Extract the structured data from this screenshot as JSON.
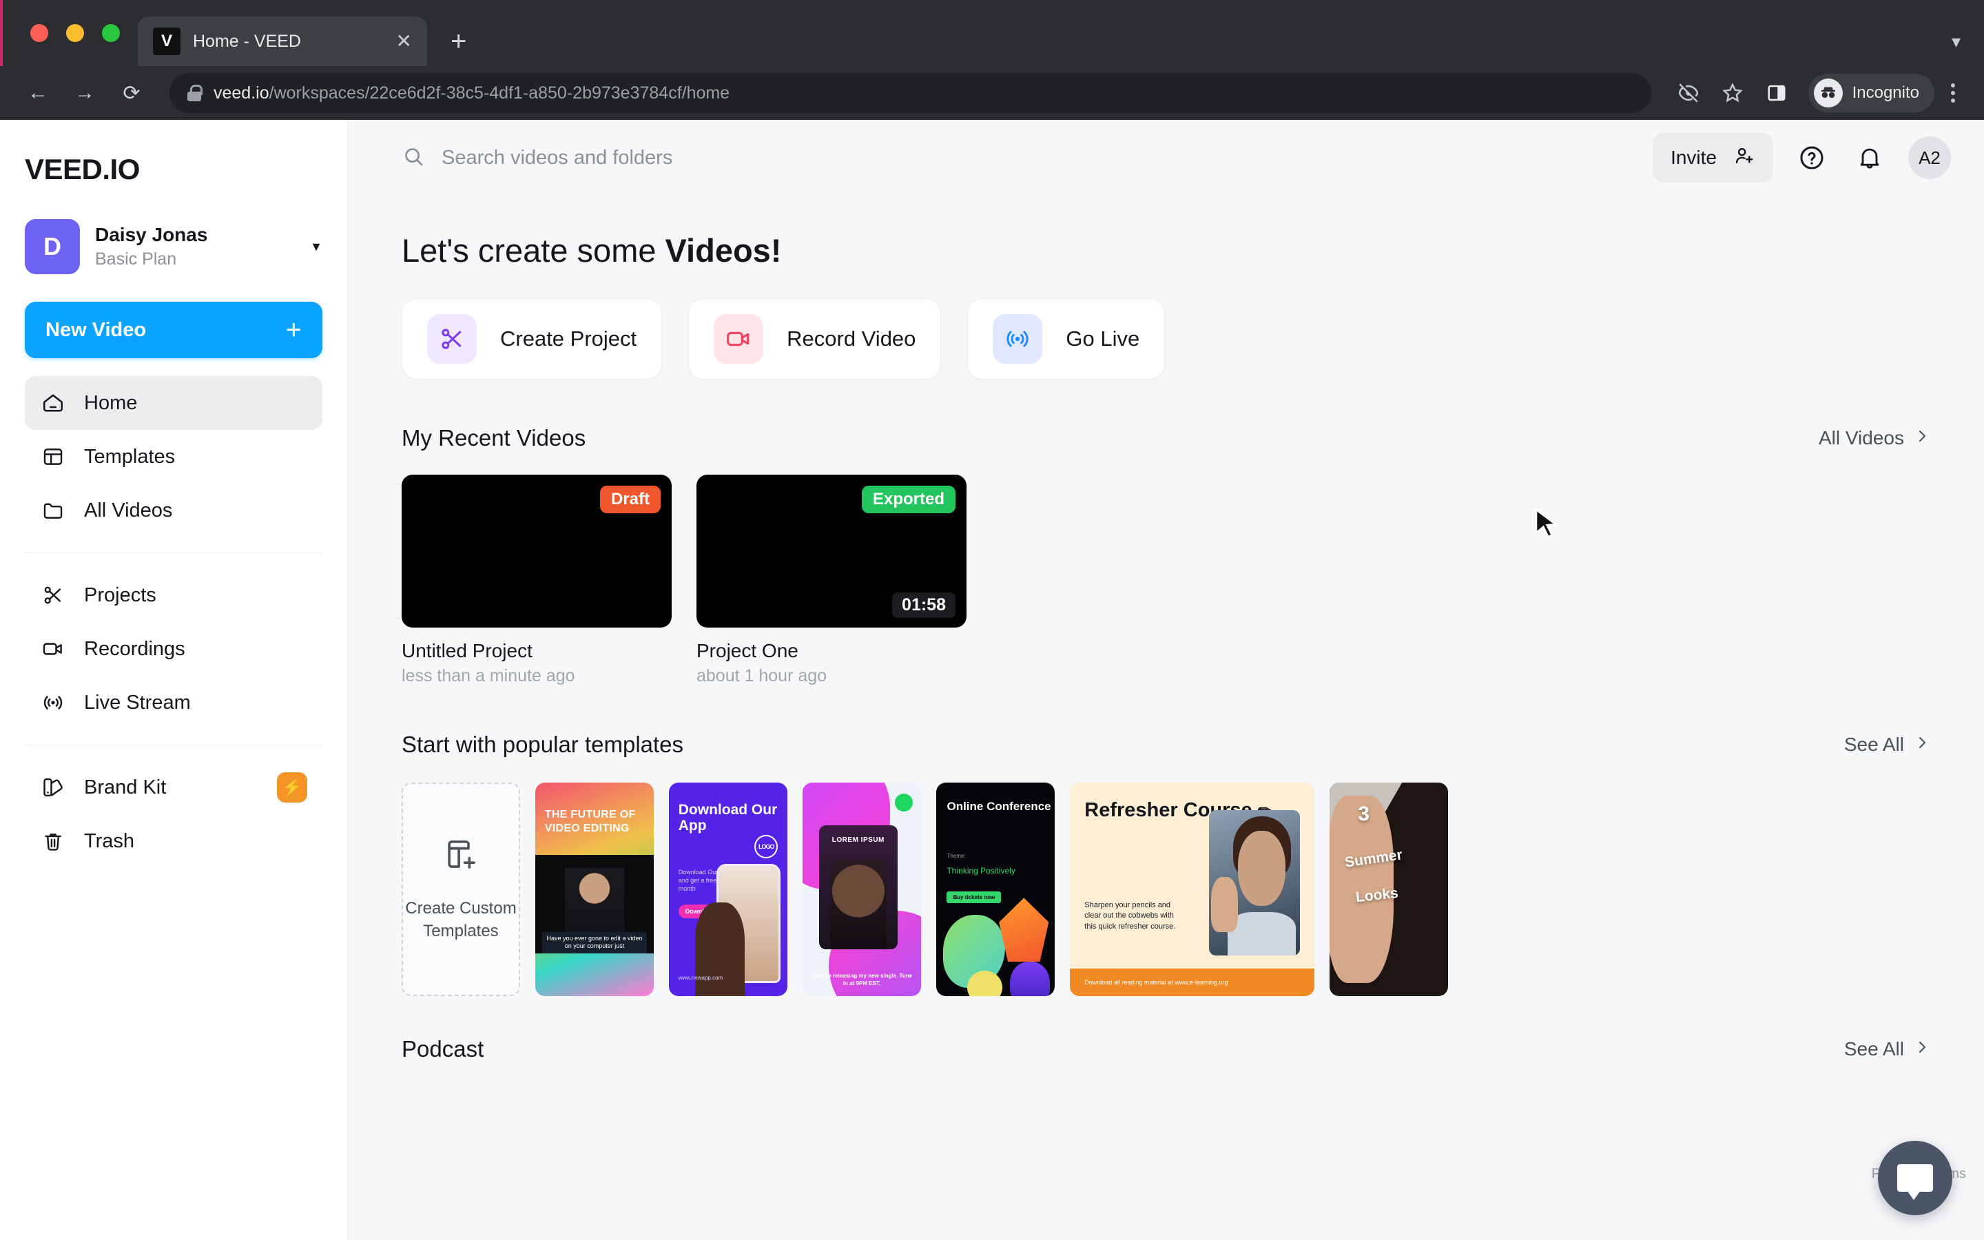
{
  "browser": {
    "tab": {
      "title": "Home - VEED",
      "favicon_letter": "V",
      "close_icon": "close-icon"
    },
    "new_tab_icon": "plus-icon",
    "tab_list_icon": "chevron-down-icon",
    "nav": {
      "back_icon": "back-arrow-icon",
      "forward_icon": "forward-arrow-icon",
      "reload_icon": "reload-icon"
    },
    "omnibox": {
      "lock_icon": "lock-icon",
      "url_domain": "veed.io",
      "url_path": "/workspaces/22ce6d2f-38c5-4df1-a850-2b973e3784cf/home"
    },
    "toolbar_icons": [
      "eye-off-icon",
      "star-icon",
      "side-panel-icon"
    ],
    "profile": {
      "label": "Incognito",
      "icon": "incognito-icon"
    },
    "menu_icon": "kebab-menu-icon"
  },
  "sidebar": {
    "logo": "VEED.IO",
    "account": {
      "avatar_letter": "D",
      "name": "Daisy Jonas",
      "plan": "Basic Plan",
      "caret_icon": "chevron-down-icon"
    },
    "new_video": {
      "label": "New Video",
      "plus": "+"
    },
    "items": [
      {
        "label": "Home",
        "icon": "home-icon",
        "active": true
      },
      {
        "label": "Templates",
        "icon": "templates-icon",
        "active": false
      },
      {
        "label": "All Videos",
        "icon": "folder-icon",
        "active": false
      },
      {
        "label": "Projects",
        "icon": "scissors-icon",
        "active": false
      },
      {
        "label": "Recordings",
        "icon": "video-camera-icon",
        "active": false
      },
      {
        "label": "Live Stream",
        "icon": "broadcast-icon",
        "active": false
      },
      {
        "label": "Brand Kit",
        "icon": "brand-kit-icon",
        "active": false,
        "badge": "bolt-icon"
      }
    ],
    "trash": {
      "label": "Trash",
      "icon": "trash-icon"
    }
  },
  "topbar": {
    "search_placeholder": "Search videos and folders",
    "search_icon": "search-icon",
    "invite": {
      "label": "Invite",
      "icon": "add-person-icon"
    },
    "help_icon": "help-circle-icon",
    "notifications_icon": "bell-icon",
    "avatar": "A2"
  },
  "main": {
    "heading_lead": "Let's create some ",
    "heading_strong": "Videos!",
    "actions": [
      {
        "label": "Create Project",
        "icon": "scissors-icon",
        "icon_bg": "#f1e7ff",
        "icon_color": "#7c3aed"
      },
      {
        "label": "Record Video",
        "icon": "video-camera-icon",
        "icon_bg": "#ffe4e8",
        "icon_color": "#f43f5e"
      },
      {
        "label": "Go Live",
        "icon": "broadcast-icon",
        "icon_bg": "#e0e7ff",
        "icon_color": "#1a8cff"
      }
    ],
    "recent": {
      "title": "My Recent Videos",
      "link": "All Videos",
      "link_icon": "chevron-right-icon",
      "videos": [
        {
          "title": "Untitled Project",
          "time": "less than a minute ago",
          "badge": "Draft",
          "badge_color": "#f2562c",
          "duration": ""
        },
        {
          "title": "Project One",
          "time": "about 1 hour ago",
          "badge": "Exported",
          "badge_color": "#22c55e",
          "duration": "01:58"
        }
      ]
    },
    "templates": {
      "title": "Start with popular templates",
      "link": "See All",
      "link_icon": "chevron-right-icon",
      "custom": {
        "label": "Create Custom Templates",
        "icon": "add-template-icon"
      },
      "items": [
        {
          "name": "future-of-video-editing",
          "headline": "THE FUTURE OF VIDEO EDITING",
          "caption": "Have you ever gone to edit a video on your computer just"
        },
        {
          "name": "download-our-app",
          "headline": "Download Our App",
          "sub": "Download Our App and get a free trial 1 month",
          "button": "Download Now",
          "logo": "LOGO",
          "url": "www.newapp.com"
        },
        {
          "name": "lorem-ipsum-single",
          "headline": "LOREM IPSUM",
          "caption": "I will be releasing my new single. Tune in at 9PM EST.",
          "badge_icon": "spotify-icon"
        },
        {
          "name": "online-conference",
          "headline": "Online Conference",
          "theme_label": "Theme:",
          "theme": "Thinking Positively",
          "button": "Buy tickets now"
        },
        {
          "name": "refresher-course",
          "headline": "Refresher Course",
          "headline_icon": "pencil-icon",
          "body": "Sharpen your pencils and clear out the cobwebs with this quick refresher course.",
          "footer": "Download all reading material at www.e-learning.org"
        },
        {
          "name": "summer-looks",
          "line1": "3",
          "line2": "Summer",
          "line3": "Looks"
        }
      ]
    },
    "podcast": {
      "title": "Podcast",
      "link": "See All",
      "link_icon": "chevron-right-icon"
    }
  },
  "overlays": {
    "chat_widget_icon": "chat-bubble-icon",
    "recaptcha": "Privacy - Terms",
    "cursor_icon": "mouse-pointer-icon"
  },
  "colors": {
    "accent_blue": "#0aa3ff",
    "avatar_purple": "#6d63f5",
    "badge_orange": "#f59428",
    "draft": "#f2562c",
    "exported": "#22c55e"
  }
}
